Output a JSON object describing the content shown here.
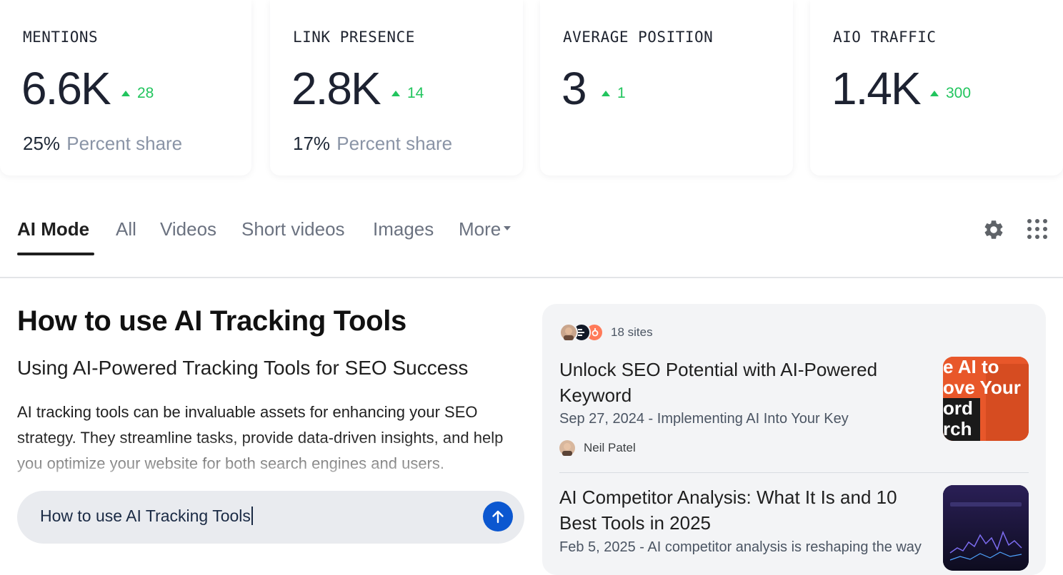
{
  "metrics": [
    {
      "label": "MENTIONS",
      "value": "6.6K",
      "delta": "28",
      "share_value": "25%",
      "share_label": "Percent share"
    },
    {
      "label": "LINK PRESENCE",
      "value": "2.8K",
      "delta": "14",
      "share_value": "17%",
      "share_label": "Percent share"
    },
    {
      "label": "AVERAGE POSITION",
      "value": "3",
      "delta": "1"
    },
    {
      "label": "AIO TRAFFIC",
      "value": "1.4K",
      "delta": "300"
    }
  ],
  "tabs": {
    "items": [
      "AI Mode",
      "All",
      "Videos",
      "Short videos",
      "Images",
      "More"
    ],
    "active": "AI Mode",
    "icons": [
      "gear-icon",
      "apps-grid-icon"
    ]
  },
  "answer": {
    "title": "How to use AI Tracking Tools",
    "subtitle": "Using AI-Powered Tracking Tools for SEO Success",
    "body": "AI tracking tools can be invaluable assets for enhancing your SEO strategy. They streamline tasks, provide data-driven insights, and help you optimize your website for both search engines and users."
  },
  "prompt": {
    "value": "How to use AI Tracking Tools",
    "send_icon": "arrow-up-icon"
  },
  "sources": {
    "count_label": "18 sites",
    "items": [
      {
        "title": "Unlock SEO Potential with AI-Powered Keyword",
        "meta": "Sep 27, 2024 - Implementing AI Into Your Key",
        "author": "Neil Patel",
        "thumb_text": [
          "e AI to",
          "ove Your",
          "ord",
          "rch"
        ]
      },
      {
        "title": "AI Competitor Analysis: What It Is and 10 Best Tools in 2025",
        "meta": "Feb 5, 2025 - AI competitor analysis is reshaping the way"
      }
    ]
  },
  "colors": {
    "delta_up": "#22c55e",
    "send_button": "#0b57d0",
    "panel_bg": "#f3f4f6"
  }
}
